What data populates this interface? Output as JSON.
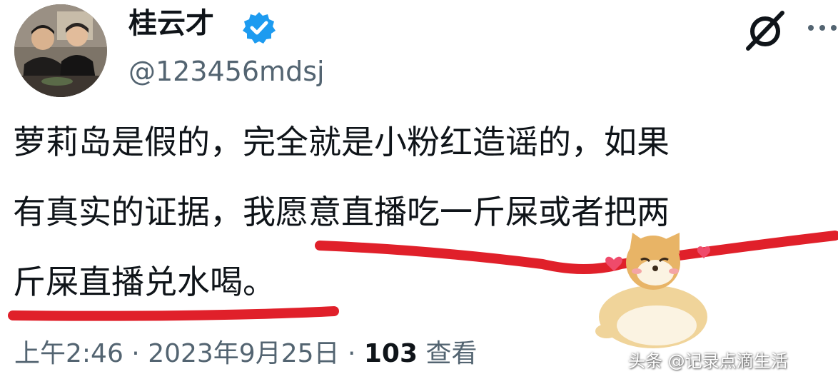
{
  "author": {
    "display_name": "桂云才",
    "handle": "@123456mdsj",
    "verified": true
  },
  "icons": {
    "verified": "verified-badge-icon",
    "brand": "x-logo-icon",
    "more": "more-options-icon",
    "sticker": "shiba-dog-sticker"
  },
  "tweet": {
    "lines": [
      "萝莉岛是假的，完全就是小粉红造谣的，如果",
      "有真实的证据，我愿意直播吃一斤屎或者把两",
      "斤屎直播兑水喝。"
    ]
  },
  "meta": {
    "time": "上午2:46",
    "separator": " · ",
    "date": "2023年9月25日",
    "views_count": "103",
    "views_label": " 查看"
  },
  "watermark": "头条 @记录点滴生活",
  "colors": {
    "verified": "#1d9bf0",
    "underline": "#e0202a",
    "secondary_text": "#536471"
  }
}
